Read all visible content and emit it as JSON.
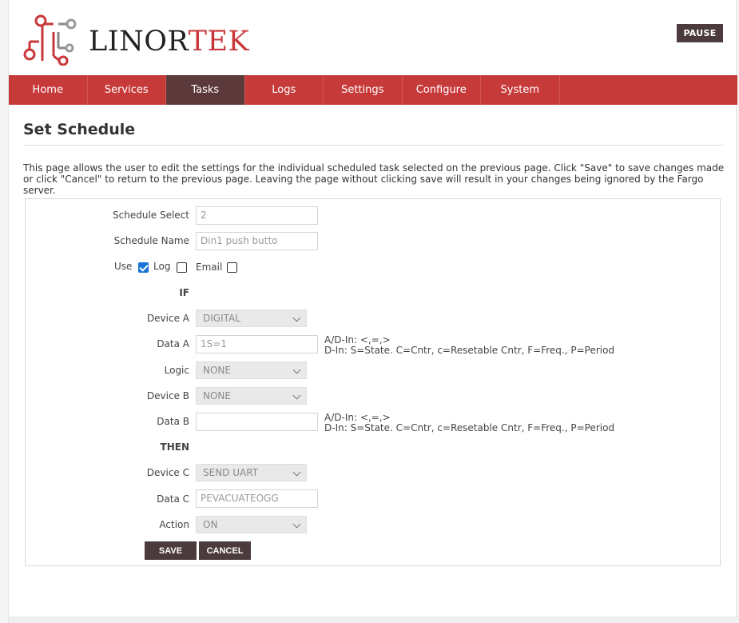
{
  "brand": {
    "name_part1": "LINOR",
    "name_part2": "TEK",
    "logo_icon": "circuit-node-logo"
  },
  "header": {
    "pause_label": "PAUSE"
  },
  "nav": {
    "items": [
      {
        "label": "Home",
        "active": false
      },
      {
        "label": "Services",
        "active": false
      },
      {
        "label": "Tasks",
        "active": true
      },
      {
        "label": "Logs",
        "active": false
      },
      {
        "label": "Settings",
        "active": false
      },
      {
        "label": "Configure",
        "active": false
      },
      {
        "label": "System",
        "active": false
      }
    ]
  },
  "page": {
    "title": "Set Schedule",
    "intro": "This page allows the user to edit the settings for the individual scheduled task selected on the previous page. Click \"Save\" to save changes made or click \"Cancel\" to return to the previous page. Leaving the page without clicking save will result in your changes being ignored by the Fargo server."
  },
  "form": {
    "schedule_select": {
      "label": "Schedule Select",
      "value": "2"
    },
    "schedule_name": {
      "label": "Schedule Name",
      "value": "Din1 push butto"
    },
    "use": {
      "label": "Use",
      "checked": true
    },
    "log": {
      "label": "Log",
      "checked": false
    },
    "email": {
      "label": "Email",
      "checked": false
    },
    "if_heading": "IF",
    "device_a": {
      "label": "Device A",
      "value": "DIGITAL"
    },
    "data_a": {
      "label": "Data A",
      "value": "1S=1"
    },
    "hint_line1": "A/D-In: <,=,>",
    "hint_line2": "D-In: S=State. C=Cntr, c=Resetable Cntr, F=Freq., P=Period",
    "logic": {
      "label": "Logic",
      "value": "NONE"
    },
    "device_b": {
      "label": "Device B",
      "value": "NONE"
    },
    "data_b": {
      "label": "Data B",
      "value": ""
    },
    "then_heading": "THEN",
    "device_c": {
      "label": "Device C",
      "value": "SEND UART"
    },
    "data_c": {
      "label": "Data C",
      "value": "PEVACUATEOGG"
    },
    "action": {
      "label": "Action",
      "value": "ON"
    },
    "save_label": "SAVE",
    "cancel_label": "CANCEL"
  },
  "colors": {
    "nav_red": "#c63a3a",
    "nav_active": "#5c3a3c",
    "button_dark": "#4b3b3d",
    "brand_red": "#c8383a",
    "checkbox_blue": "#1a73d8"
  }
}
